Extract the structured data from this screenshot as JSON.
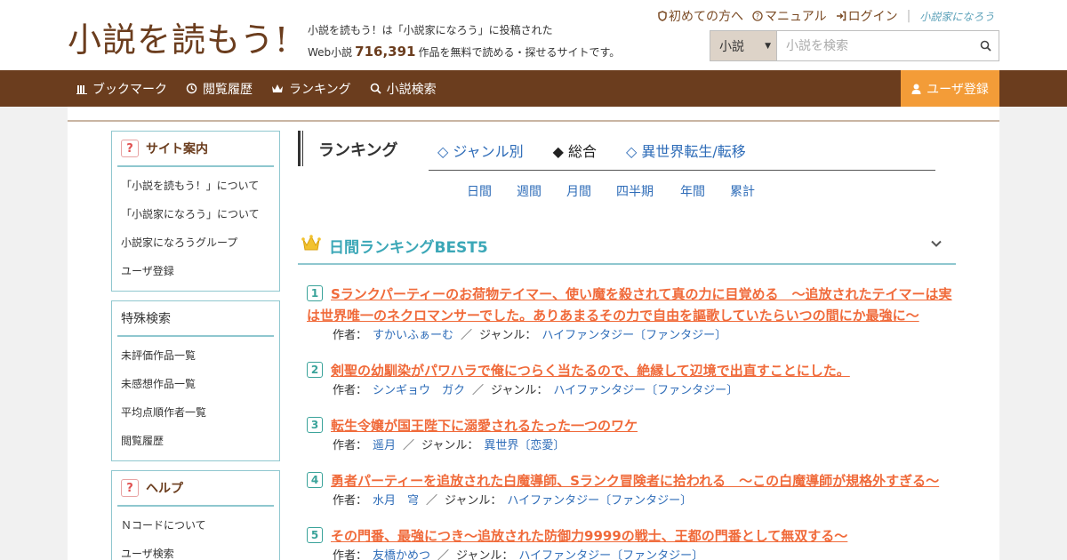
{
  "header": {
    "logo": "小説を読もう!",
    "tagline_line1": "小説を読もう！は「小説家になろう」に投稿された",
    "tagline_prefix": "Web小説",
    "novel_count": "716,391",
    "tagline_suffix": "作品を無料で読める・探せるサイトです。",
    "links": {
      "first_time": "初めての方へ",
      "manual": "マニュアル",
      "login": "ログイン",
      "brand": "小説家になろう"
    },
    "search": {
      "select_value": "小説",
      "placeholder": "小説を検索"
    }
  },
  "nav": {
    "bookmark": "ブックマーク",
    "history": "閲覧履歴",
    "ranking": "ランキング",
    "search": "小説検索",
    "register": "ユーザ登録"
  },
  "sidebar": {
    "site_info": {
      "title": "サイト案内",
      "items": [
        "「小説を読もう！」について",
        "「小説家になろう」について",
        "小説家になろうグループ",
        "ユーザ登録"
      ]
    },
    "special_search": {
      "title": "特殊検索",
      "items": [
        "未評価作品一覧",
        "未感想作品一覧",
        "平均点順作者一覧",
        "閲覧履歴"
      ]
    },
    "help": {
      "title": "ヘルプ",
      "items": [
        "Ｎコードについて",
        "ユーザ検索"
      ]
    }
  },
  "ranking": {
    "title": "ランキング",
    "tabs": [
      "◇ ジャンル別",
      "◆ 総合",
      "◇ 異世界転生/転移"
    ],
    "periods": [
      "日間",
      "週間",
      "月間",
      "四半期",
      "年間",
      "累計"
    ],
    "section_title": "日間ランキングBEST5",
    "author_label": "作者：",
    "genre_label": "ジャンル：",
    "entries": [
      {
        "rank": "1",
        "title": "Sランクパーティーのお荷物テイマー、使い魔を殺されて真の力に目覚める　〜追放されたテイマーは実は世界唯一のネクロマンサーでした。ありあまるその力で自由を謳歌していたらいつの間にか最強に〜",
        "author": "すかいふぁーむ",
        "genre": "ハイファンタジー〔ファンタジー〕"
      },
      {
        "rank": "2",
        "title": "剣聖の幼馴染がパワハラで俺につらく当たるので、絶縁して辺境で出直すことにした。",
        "author": "シンギョウ　ガク",
        "genre": "ハイファンタジー〔ファンタジー〕"
      },
      {
        "rank": "3",
        "title": "転生令嬢が国王陛下に溺愛されるたった一つのワケ",
        "author": "遥月",
        "genre": "異世界〔恋愛〕"
      },
      {
        "rank": "4",
        "title": "勇者パーティーを追放された白魔導師、Sランク冒険者に拾われる　～この白魔導師が規格外すぎる～",
        "author": "水月　穹",
        "genre": "ハイファンタジー〔ファンタジー〕"
      },
      {
        "rank": "5",
        "title": "その門番、最強につき～追放された防御力9999の戦士、王都の門番として無双する～",
        "author": "友橋かめつ",
        "genre": "ハイファンタジー〔ファンタジー〕"
      }
    ]
  },
  "colors": {
    "brand_brown": "#6b3d1e",
    "accent_orange": "#f39c38",
    "link_blue": "#2e6cb8",
    "title_orange": "#f06a3a",
    "teal": "#3ba7b7"
  }
}
